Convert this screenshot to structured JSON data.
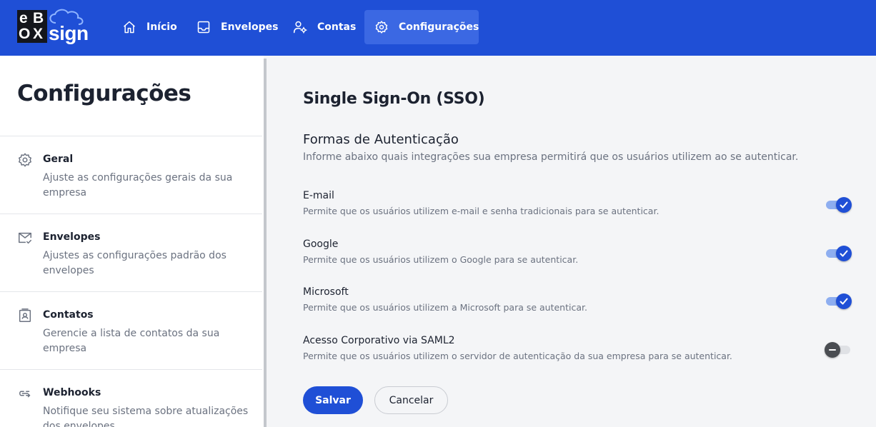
{
  "brand": {
    "logo_letters": [
      "e",
      "B",
      "O",
      "X"
    ],
    "logo_word": "sign",
    "primary_color": "#1f4fd6"
  },
  "nav": {
    "items": [
      {
        "label": "Início",
        "icon": "home-icon"
      },
      {
        "label": "Envelopes",
        "icon": "inbox-icon"
      },
      {
        "label": "Contas",
        "icon": "users-cog-icon"
      },
      {
        "label": "Configurações",
        "icon": "gear-icon",
        "active": true
      }
    ]
  },
  "sidebar": {
    "title": "Configurações",
    "items": [
      {
        "name": "Geral",
        "description": "Ajuste as configurações gerais da sua empresa",
        "icon": "gear-icon"
      },
      {
        "name": "Envelopes",
        "description": "Ajustes as configurações padrão dos envelopes",
        "icon": "mail-check-icon"
      },
      {
        "name": "Contatos",
        "description": "Gerencie a lista de contatos da sua empresa",
        "icon": "contact-card-icon"
      },
      {
        "name": "Webhooks",
        "description": "Notifique seu sistema sobre atualizações dos envelopes",
        "icon": "webhook-link-icon"
      }
    ]
  },
  "main": {
    "title": "Single Sign-On (SSO)",
    "section_title": "Formas de Autenticação",
    "section_description": "Informe abaixo quais integrações sua empresa permitirá que os usuários utilizem ao se autenticar.",
    "options": [
      {
        "name": "E-mail",
        "description": "Permite que os usuários utilizem e-mail e senha tradicionais para se autenticar.",
        "enabled": true
      },
      {
        "name": "Google",
        "description": "Permite que os usuários utilizem o Google para se autenticar.",
        "enabled": true
      },
      {
        "name": "Microsoft",
        "description": "Permite que os usuários utilizem a Microsoft para se autenticar.",
        "enabled": true
      },
      {
        "name": "Acesso Corporativo via SAML2",
        "description": "Permite que os usuários utilizem o servidor de autenticação da sua empresa para se autenticar.",
        "enabled": false
      }
    ],
    "save_label": "Salvar",
    "cancel_label": "Cancelar"
  }
}
